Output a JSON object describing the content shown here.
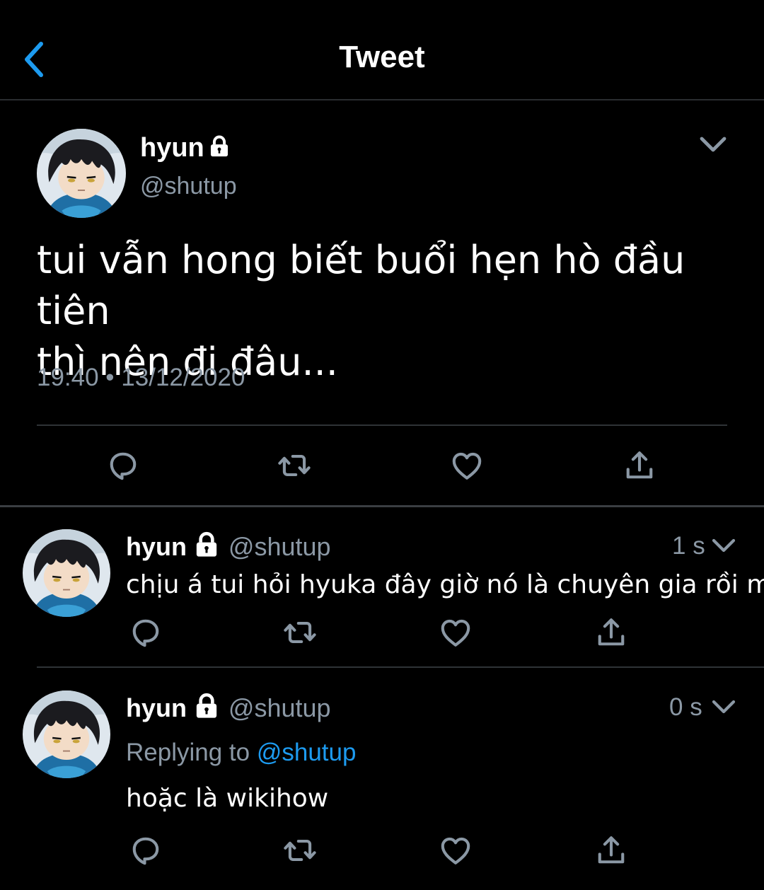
{
  "header": {
    "title": "Tweet"
  },
  "tweet": {
    "author_name": "hyun",
    "author_handle": "@shutup",
    "text_line1": "tui vẫn hong biết buổi hẹn hò đầu tiên",
    "text_line2": "thì nên đi đâu...",
    "timestamp": "19:40 • 13/12/2020"
  },
  "replies": [
    {
      "author_name": "hyun",
      "author_handle": "@shutup",
      "time": "1 s",
      "text": "chịu á tui hỏi hyuka đây giờ nó là chuyên gia rồi mà"
    },
    {
      "author_name": "hyun",
      "author_handle": "@shutup",
      "time": "0 s",
      "replying_label": "Replying to",
      "replying_handle": "@shutup",
      "text": "hoặc là wikihow"
    }
  ],
  "icons": {
    "back": "chevron-left-icon",
    "menu": "chevron-down-icon",
    "lock": "lock-icon",
    "reply": "reply-icon",
    "retweet": "retweet-icon",
    "like": "heart-icon",
    "share": "share-icon"
  },
  "colors": {
    "background": "#000000",
    "accent": "#1d9bf0",
    "secondary_text": "#8b98a5",
    "divider": "#2f3336"
  }
}
